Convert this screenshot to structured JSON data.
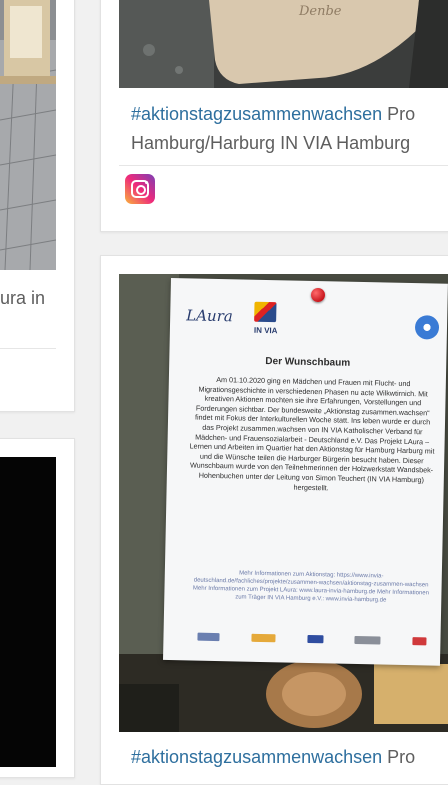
{
  "posts": [
    {
      "partial_caption": "ura in"
    },
    {
      "hashtag": "#aktionstagzusammenwachsen",
      "caption_rest": " Pro",
      "caption_line2": "Hamburg/Harburg IN VIA Hamburg",
      "photo_text": "Denbe"
    },
    {
      "hashtag": "#aktionstagzusammenwachsen",
      "caption_rest": " Pro",
      "notice": {
        "logo_left": "LAura",
        "logo_mid": "IN VIA",
        "title": "Der Wunschbaum",
        "body": "Am 01.10.2020 ging en Mädchen und Frauen mit Flucht- und Migrationsgeschichte in verschiedenen Phasen nu acte Wilkwtirnich. Mit kreativen Aktionen mochten sie ihre Erfahrungen, Vorstellungen und Forderungen sichtbar. Der bundesweite „Aktionstag zusammen.wachsen“ findet mit Fokus der Interkulturellen Woche statt. Ins leben wurde er durch das Projekt zusammen.wachsen von IN VIA Katholischer Verband für Mädchen- und Frauensozialarbeit - Deutschland e.V. Das Projekt LAura – Lernen und Arbeiten im Quartier hat den Aktionstag für Hamburg Harburg mit und die Wünsche teilen die Harburger Bürgerin besucht haben. Dieser Wunschbaum wurde von den Teilnehmerinnen der Holzwerkstatt Wandsbek-Hohenbuchen unter der Leitung von Simon Teuchert (IN VIA Hamburg) hergestellt.",
        "info": "Mehr Informationen zum Aktionstag: https://www.invia-deutschland.de/fachliches/projekte/zusammen-wachsen/aktionstag-zusammen-wachsen Mehr Informationen zum Projekt LAura: www.laura-invia-hamburg.de Mehr Informationen zum Träger IN VIA Hamburg e.V.: www.invia-hamburg.de"
      }
    }
  ],
  "colors": {
    "hashtag": "#2e6f9e",
    "caption": "#5e5e5e",
    "page_background": "#f1f1f1",
    "card_background": "#ffffff"
  },
  "icons": [
    "instagram-icon"
  ]
}
